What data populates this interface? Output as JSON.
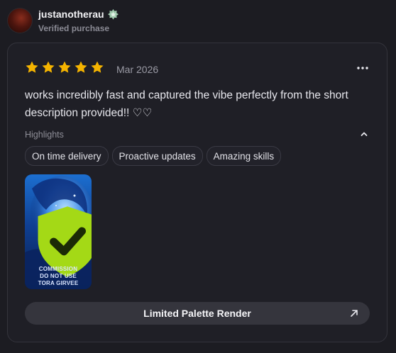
{
  "user": {
    "username": "justanotherau",
    "subtitle": "Verified purchase",
    "badge_icon": "level-badge-icon"
  },
  "review": {
    "rating": 5,
    "rating_max": 5,
    "date": "Mar 2026",
    "text": "works incredibly fast and captured the vibe perfectly from the short description provided!! ♡♡",
    "highlights_label": "Highlights",
    "highlights": [
      "On time delivery",
      "Proactive updates",
      "Amazing skills"
    ],
    "image": {
      "verified_icon": "shield-check-icon",
      "watermark": [
        "COMMISSION",
        "DO NOT USE",
        "TORA GIRVEE"
      ]
    },
    "product_label": "Limited Palette Render"
  },
  "colors": {
    "star": "#f5b400",
    "background": "#1c1c22",
    "card_border": "#34343c",
    "shield": "#a4d916"
  }
}
